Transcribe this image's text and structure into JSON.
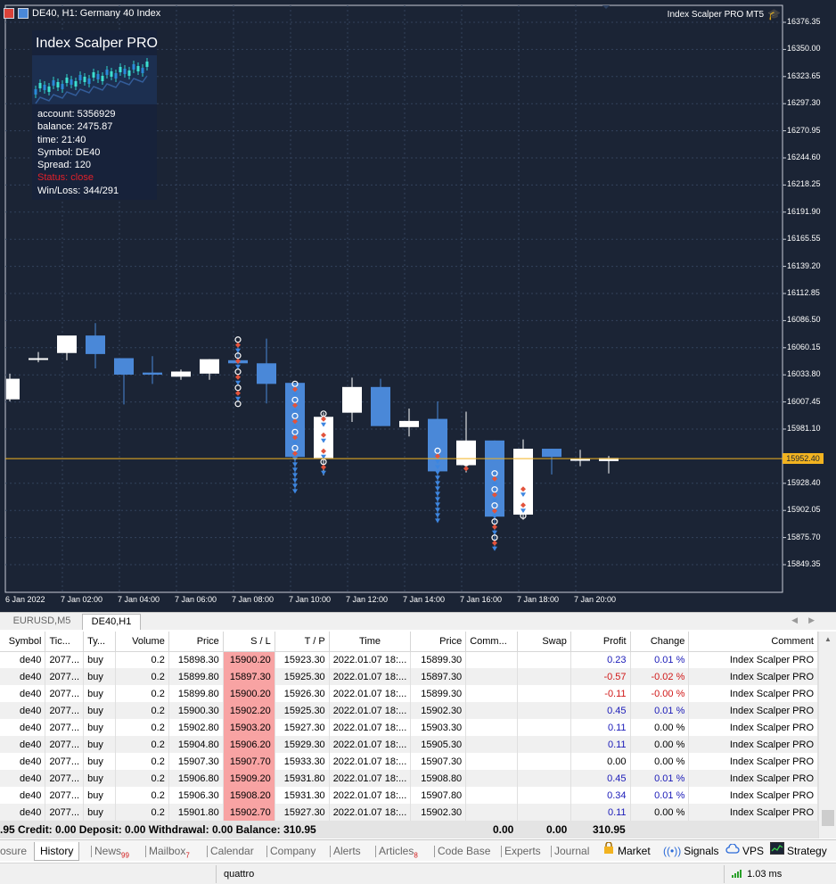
{
  "chart": {
    "symbol_label": "DE40, H1:  Germany 40 Index",
    "ea_label": "Index Scalper PRO MT5",
    "current_price": "15952.40",
    "price_labels": [
      "16376.35",
      "16350.00",
      "16323.65",
      "16297.30",
      "16270.95",
      "16244.60",
      "16218.25",
      "16191.90",
      "16165.55",
      "16139.20",
      "16112.85",
      "16086.50",
      "16060.15",
      "16033.80",
      "16007.45",
      "15981.10",
      "15928.40",
      "15902.05",
      "15875.70",
      "15849.35"
    ],
    "time_labels": [
      "6 Jan 2022",
      "7 Jan 02:00",
      "7 Jan 04:00",
      "7 Jan 06:00",
      "7 Jan 08:00",
      "7 Jan 10:00",
      "7 Jan 12:00",
      "7 Jan 14:00",
      "7 Jan 16:00",
      "7 Jan 18:00",
      "7 Jan 20:00"
    ],
    "colors": {
      "background": "#1b2435",
      "grid": "#33425c",
      "bull": "#ffffff",
      "bear": "#4a88d8",
      "price_line": "#f2b320"
    },
    "chart_data": {
      "type": "candlestick",
      "timeframe": "H1",
      "ylim": [
        15835,
        16390
      ],
      "candles": [
        {
          "t": "6 Jan 23:00",
          "o": 16010,
          "h": 16035,
          "c": 16030,
          "l": 16008
        },
        {
          "t": "7 Jan 01:00",
          "o": 16050,
          "h": 16056,
          "c": 16050,
          "l": 16046
        },
        {
          "t": "7 Jan 02:00",
          "o": 16055,
          "h": 16070,
          "c": 16072,
          "l": 16048
        },
        {
          "t": "7 Jan 03:00",
          "o": 16072,
          "h": 16084,
          "c": 16054,
          "l": 16040
        },
        {
          "t": "7 Jan 04:00",
          "o": 16050,
          "h": 16050,
          "c": 16034,
          "l": 16005
        },
        {
          "t": "7 Jan 05:00",
          "o": 16036,
          "h": 16052,
          "c": 16034,
          "l": 16025
        },
        {
          "t": "7 Jan 06:00",
          "o": 16032,
          "h": 16039,
          "c": 16037,
          "l": 16029
        },
        {
          "t": "7 Jan 07:00",
          "o": 16035,
          "h": 16049,
          "c": 16049,
          "l": 16029
        },
        {
          "t": "7 Jan 08:00",
          "o": 16048,
          "h": 16061,
          "c": 16045,
          "l": 16044
        },
        {
          "t": "7 Jan 09:00",
          "o": 16045,
          "h": 16069,
          "c": 16025,
          "l": 16006
        },
        {
          "t": "7 Jan 10:00",
          "o": 16026,
          "h": 16026,
          "c": 15954,
          "l": 15921
        },
        {
          "t": "7 Jan 11:00",
          "o": 15953,
          "h": 15997,
          "c": 15993,
          "l": 15936
        },
        {
          "t": "7 Jan 12:00",
          "o": 15997,
          "h": 16031,
          "c": 16022,
          "l": 15988
        },
        {
          "t": "7 Jan 13:00",
          "o": 16022,
          "h": 16030,
          "c": 15984,
          "l": 15984
        },
        {
          "t": "7 Jan 14:00",
          "o": 15983,
          "h": 16001,
          "c": 15989,
          "l": 15974
        },
        {
          "t": "7 Jan 15:00",
          "o": 15991,
          "h": 16008,
          "c": 15940,
          "l": 15890
        },
        {
          "t": "7 Jan 16:00",
          "o": 15946,
          "h": 15998,
          "c": 15970,
          "l": 15939
        },
        {
          "t": "7 Jan 17:00",
          "o": 15970,
          "h": 15970,
          "c": 15896,
          "l": 15865
        },
        {
          "t": "7 Jan 18:00",
          "o": 15898,
          "h": 15971,
          "c": 15962,
          "l": 15893
        },
        {
          "t": "7 Jan 19:00",
          "o": 15962,
          "h": 15962,
          "c": 15954,
          "l": 15937
        },
        {
          "t": "7 Jan 20:00",
          "o": 15952,
          "h": 15961,
          "c": 15952,
          "l": 15945
        },
        {
          "t": "7 Jan 21:00",
          "o": 15950,
          "h": 15955,
          "c": 15953,
          "l": 15938
        }
      ],
      "trade_marks": [
        {
          "x": 8,
          "from": 16068,
          "to": 16005
        },
        {
          "x": 10,
          "from": 16025,
          "to": 15920
        },
        {
          "x": 11,
          "from": 15996,
          "to": 15934
        },
        {
          "x": 15,
          "from": 15960,
          "to": 15890
        },
        {
          "x": 16,
          "from": 15948,
          "to": 15940
        },
        {
          "x": 17,
          "from": 15938,
          "to": 15864
        },
        {
          "x": 18,
          "from": 15928,
          "to": 15895
        }
      ]
    }
  },
  "panel": {
    "title": "Index Scalper PRO",
    "lines": [
      "account: 5356929",
      "balance: 2475.87",
      "time: 21:40",
      "Symbol: DE40",
      "Spread: 120"
    ],
    "status": "Status: close",
    "winloss": "Win/Loss: 344/291"
  },
  "chart_tabs": [
    {
      "label": "EURUSD,M5",
      "active": false
    },
    {
      "label": "DE40,H1",
      "active": true
    }
  ],
  "table": {
    "headers": [
      "Symbol",
      "Tic...",
      "Ty...",
      "Volume",
      "Price",
      "S / L",
      "T / P",
      "Time",
      "Price",
      "Comm...",
      "Swap",
      "Profit",
      "Change",
      "Comment"
    ],
    "rows": [
      [
        "de40",
        "2077...",
        "buy",
        "0.2",
        "15898.30",
        "15900.20",
        "15923.30",
        "2022.01.07 18:...",
        "15899.30",
        "",
        "",
        "0.23",
        "0.01 %",
        "Index Scalper PRO"
      ],
      [
        "de40",
        "2077...",
        "buy",
        "0.2",
        "15899.80",
        "15897.30",
        "15925.30",
        "2022.01.07 18:...",
        "15897.30",
        "",
        "",
        "-0.57",
        "-0.02 %",
        "Index Scalper PRO"
      ],
      [
        "de40",
        "2077...",
        "buy",
        "0.2",
        "15899.80",
        "15900.20",
        "15926.30",
        "2022.01.07 18:...",
        "15899.30",
        "",
        "",
        "-0.11",
        "-0.00 %",
        "Index Scalper PRO"
      ],
      [
        "de40",
        "2077...",
        "buy",
        "0.2",
        "15900.30",
        "15902.20",
        "15925.30",
        "2022.01.07 18:...",
        "15902.30",
        "",
        "",
        "0.45",
        "0.01 %",
        "Index Scalper PRO"
      ],
      [
        "de40",
        "2077...",
        "buy",
        "0.2",
        "15902.80",
        "15903.20",
        "15927.30",
        "2022.01.07 18:...",
        "15903.30",
        "",
        "",
        "0.11",
        "0.00 %",
        "Index Scalper PRO"
      ],
      [
        "de40",
        "2077...",
        "buy",
        "0.2",
        "15904.80",
        "15906.20",
        "15929.30",
        "2022.01.07 18:...",
        "15905.30",
        "",
        "",
        "0.11",
        "0.00 %",
        "Index Scalper PRO"
      ],
      [
        "de40",
        "2077...",
        "buy",
        "0.2",
        "15907.30",
        "15907.70",
        "15933.30",
        "2022.01.07 18:...",
        "15907.30",
        "",
        "",
        "0.00",
        "0.00 %",
        "Index Scalper PRO"
      ],
      [
        "de40",
        "2077...",
        "buy",
        "0.2",
        "15906.80",
        "15909.20",
        "15931.80",
        "2022.01.07 18:...",
        "15908.80",
        "",
        "",
        "0.45",
        "0.01 %",
        "Index Scalper PRO"
      ],
      [
        "de40",
        "2077...",
        "buy",
        "0.2",
        "15906.30",
        "15908.20",
        "15931.30",
        "2022.01.07 18:...",
        "15907.80",
        "",
        "",
        "0.34",
        "0.01 %",
        "Index Scalper PRO"
      ],
      [
        "de40",
        "2077...",
        "buy",
        "0.2",
        "15901.80",
        "15902.70",
        "15927.30",
        "2022.01.07 18:...",
        "15902.30",
        "",
        "",
        "0.11",
        "0.00 %",
        "Index Scalper PRO"
      ]
    ],
    "summary": ".95  Credit: 0.00  Deposit: 0.00  Withdrawal: 0.00  Balance: 310.95",
    "summary_comm": "0.00",
    "summary_swap": "0.00",
    "summary_profit": "310.95"
  },
  "bottom_tabs": [
    {
      "label": "osure",
      "badge": ""
    },
    {
      "label": "History",
      "badge": "",
      "active": true
    },
    {
      "label": "News",
      "badge": "99"
    },
    {
      "label": "Mailbox",
      "badge": "7"
    },
    {
      "label": "Calendar",
      "badge": ""
    },
    {
      "label": "Company",
      "badge": ""
    },
    {
      "label": "Alerts",
      "badge": ""
    },
    {
      "label": "Articles",
      "badge": "8"
    },
    {
      "label": "Code Base",
      "badge": ""
    },
    {
      "label": "Experts",
      "badge": ""
    },
    {
      "label": "Journal",
      "badge": ""
    }
  ],
  "bottom_right": {
    "market": "Market",
    "signals": "Signals",
    "vps": "VPS",
    "strategy": "Strategy"
  },
  "status_bar": {
    "profile": "quattro",
    "ping": "1.03 ms"
  }
}
